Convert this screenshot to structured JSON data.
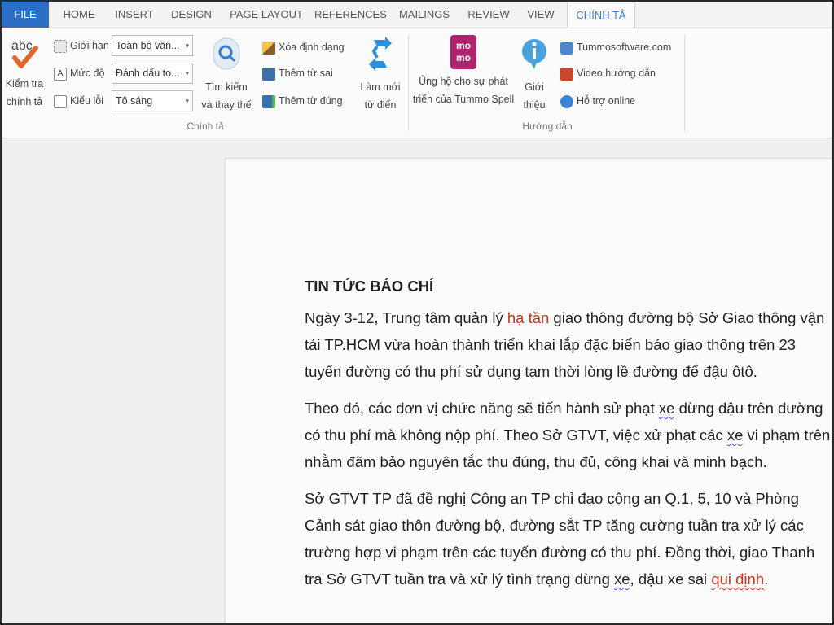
{
  "tabs": [
    "FILE",
    "HOME",
    "INSERT",
    "DESIGN",
    "PAGE LAYOUT",
    "REFERENCES",
    "MAILINGS",
    "REVIEW",
    "VIEW",
    "CHÍNH TẢ"
  ],
  "ribbon": {
    "check": {
      "line1": "Kiểm tra",
      "line2": "chính tả"
    },
    "options": [
      {
        "label": "Giới hạn",
        "value": "Toàn bộ văn...",
        "icon": "scope-icon"
      },
      {
        "label": "Mức độ",
        "value": "Đánh dấu to...",
        "icon": "level-icon"
      },
      {
        "label": "Kiểu lỗi",
        "value": "Tô sáng",
        "icon": "error-style-icon"
      }
    ],
    "find": {
      "line1": "Tìm kiếm",
      "line2": "và thay thế"
    },
    "actions": [
      "Xóa định dạng",
      "Thêm từ sai",
      "Thêm từ đúng"
    ],
    "refresh": {
      "line1": "Làm mới",
      "line2": "từ điển"
    },
    "support": {
      "line1": "Ủng hộ cho sự phát",
      "line2": "triển của Tummo Spell",
      "logo_line1": "mo",
      "logo_line2": "mo"
    },
    "intro": {
      "line1": "Giới",
      "line2": "thiệu"
    },
    "links": [
      "Tummosoftware.com",
      "Video hướng dẫn",
      "Hỗ trợ online"
    ],
    "group_spelling": "Chính tả",
    "group_guide": "Hướng dẫn"
  },
  "document": {
    "title": "TIN TỨC BÁO CHÍ",
    "p1": {
      "a": "Ngày 3-12, Trung tâm quản lý ",
      "err": "hạ tần",
      "b": " giao thông đường bộ Sở Giao thông vận tải TP.HCM vừa hoàn thành triển khai lắp đặc biển báo giao thông trên 23 tuyến đường có thu phí sử dụng tạm thời lòng lề đường để đậu ôtô."
    },
    "p2": {
      "a": "Theo đó, các đơn vị chức năng sẽ tiến hành sử phạt ",
      "w1": "xe",
      "b": " dừng đậu trên đường có thu phí mà không nộp phí. Theo Sở GTVT, việc xử phạt các ",
      "w2": "xe",
      "c": " vi phạm trên nhằm đãm bảo nguyên tắc thu đúng, thu đủ, công khai và minh bạch."
    },
    "p3": {
      "a": "Sở GTVT TP đã đề nghị Công an TP chỉ đạo công an Q.1, 5, 10 và Phòng Cảnh sát giao thôn đường bộ, đường sắt TP tăng cường tuần tra xử lý các trường hợp vi phạm trên các tuyến đường có thu phí. Đồng thời, giao Thanh tra Sở GTVT tuần tra và xử lý tình trạng dừng ",
      "w1": "xe",
      "b": ", đậu xe sai ",
      "err": "qui định",
      "c": "."
    }
  }
}
